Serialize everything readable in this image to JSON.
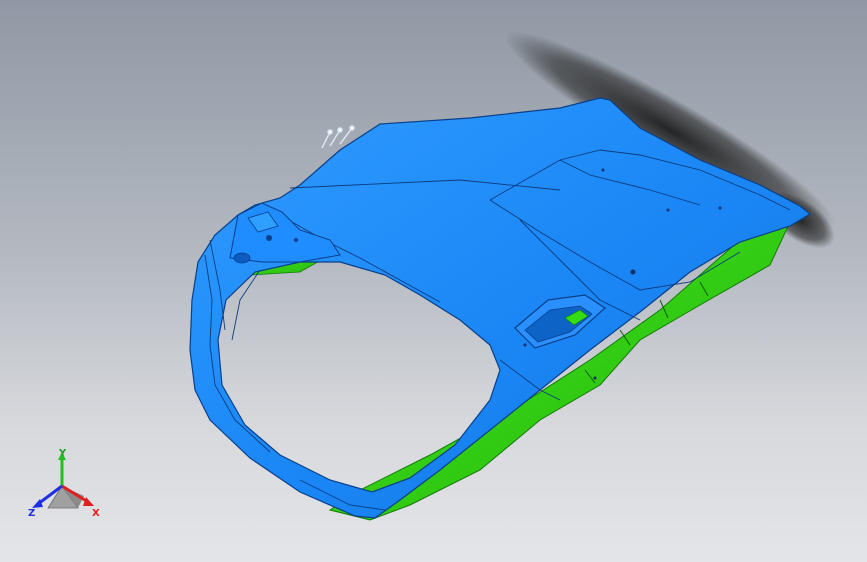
{
  "triad": {
    "x_label": "X",
    "y_label": "Y",
    "z_label": "Z"
  },
  "colors": {
    "background_top": "#8f98a4",
    "background_bottom": "#e4e5e8",
    "part_surface": "#1a8cff",
    "part_edge": "#0a3f8a",
    "inner_panel": "#33dd11",
    "shadow": "#2a2a2a",
    "axis_x": "#e02020",
    "axis_y": "#20c020",
    "axis_z": "#2030e0"
  }
}
